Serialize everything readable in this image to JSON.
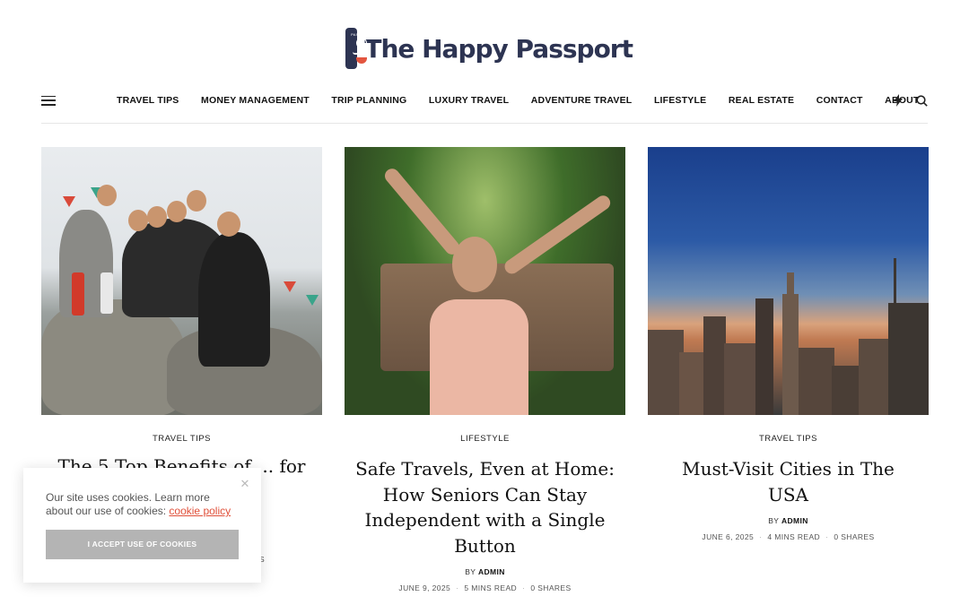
{
  "site": {
    "name": "The Happy Passport",
    "badge_text": "PASSPORT"
  },
  "nav": {
    "items": [
      {
        "label": "TRAVEL TIPS"
      },
      {
        "label": "MONEY MANAGEMENT"
      },
      {
        "label": "TRIP PLANNING"
      },
      {
        "label": "LUXURY TRAVEL"
      },
      {
        "label": "ADVENTURE TRAVEL"
      },
      {
        "label": "LIFESTYLE"
      },
      {
        "label": "REAL ESTATE"
      },
      {
        "label": "CONTACT"
      },
      {
        "label": "ABOUT"
      }
    ],
    "icons": [
      "menu-icon",
      "lightning-icon",
      "search-icon"
    ]
  },
  "posts": [
    {
      "category": "TRAVEL TIPS",
      "title": "The 5 Top Benefits of ... for",
      "image": "group-hikers-photo",
      "meta_tail": "S"
    },
    {
      "category": "LIFESTYLE",
      "title": "Safe Travels, Even at Home: How Seniors Can Stay Independent with a Single Button",
      "by_label": "BY",
      "author": "ADMIN",
      "date": "JUNE 9, 2025",
      "read_time": "5 MINS READ",
      "shares": "0 SHARES",
      "image": "senior-woman-photo"
    },
    {
      "category": "TRAVEL TIPS",
      "title": "Must-Visit Cities in The USA",
      "by_label": "BY",
      "author": "ADMIN",
      "date": "JUNE 6, 2025",
      "read_time": "4 MINS READ",
      "shares": "0 SHARES",
      "image": "city-skyline-photo"
    }
  ],
  "cookie": {
    "text": "Our site uses cookies. Learn more about our use of cookies: ",
    "link": "cookie policy",
    "button": "I ACCEPT USE OF COOKIES",
    "close_icon": "close-icon"
  },
  "colors": {
    "brand": "#2d3452",
    "accent": "#e0503a",
    "cookie_button": "#b4b4b4"
  }
}
